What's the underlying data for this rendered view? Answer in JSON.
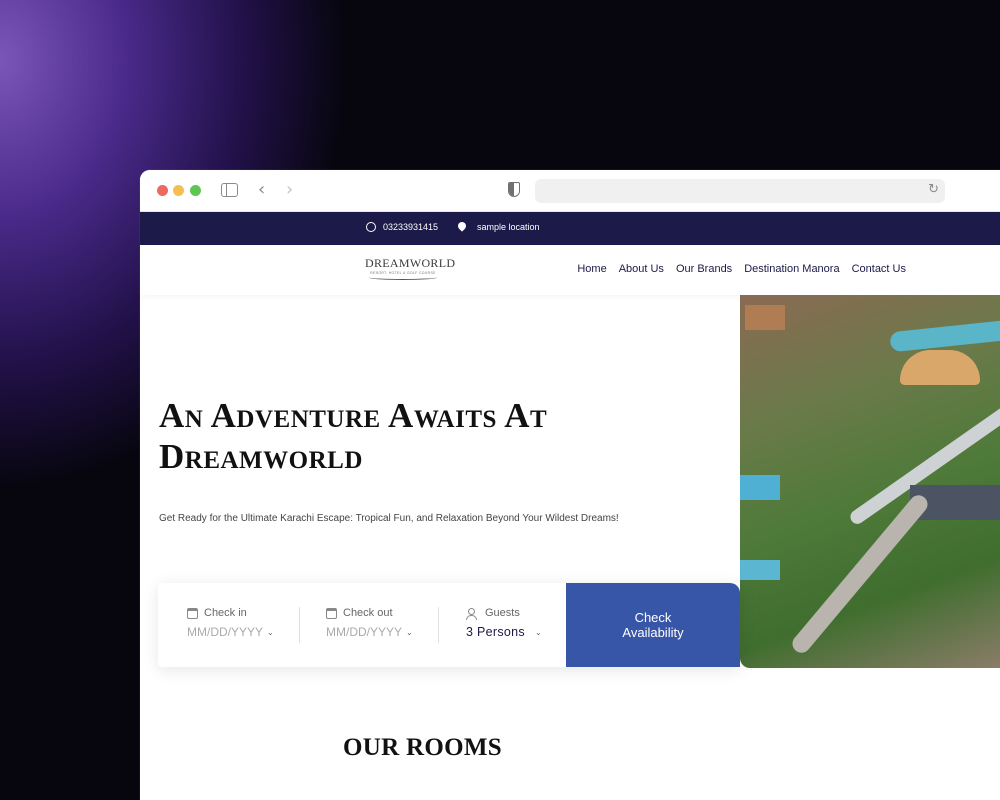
{
  "topbar": {
    "phone": "03233931415",
    "location": "sample location",
    "whatsapp_icon": "whatsapp-icon",
    "location_icon": "map-pin-icon",
    "background": "#1b1a48"
  },
  "header": {
    "logo_name": "DREAMWORLD",
    "logo_tagline": "RESORT, HOTEL & GOLF COURSE",
    "menu": [
      "Home",
      "About Us",
      "Our Brands",
      "Destination Manora",
      "Contact Us"
    ]
  },
  "hero": {
    "title_line1": "An Adventure Awaits At",
    "title_line2": "Dreamworld",
    "subtitle": "Get Ready for the Ultimate Karachi Escape: Tropical Fun, and Relaxation Beyond Your Wildest Dreams!"
  },
  "booking": {
    "check_in_label": "Check in",
    "check_in_placeholder": "MM/DD/YYYY",
    "check_out_label": "Check out",
    "check_out_placeholder": "MM/DD/YYYY",
    "guests_label": "Guests",
    "guests_value": "3 Persons",
    "button_label": "Check Availability",
    "accent": "#3856a8"
  },
  "rooms": {
    "title": "OUR ROOMS"
  }
}
